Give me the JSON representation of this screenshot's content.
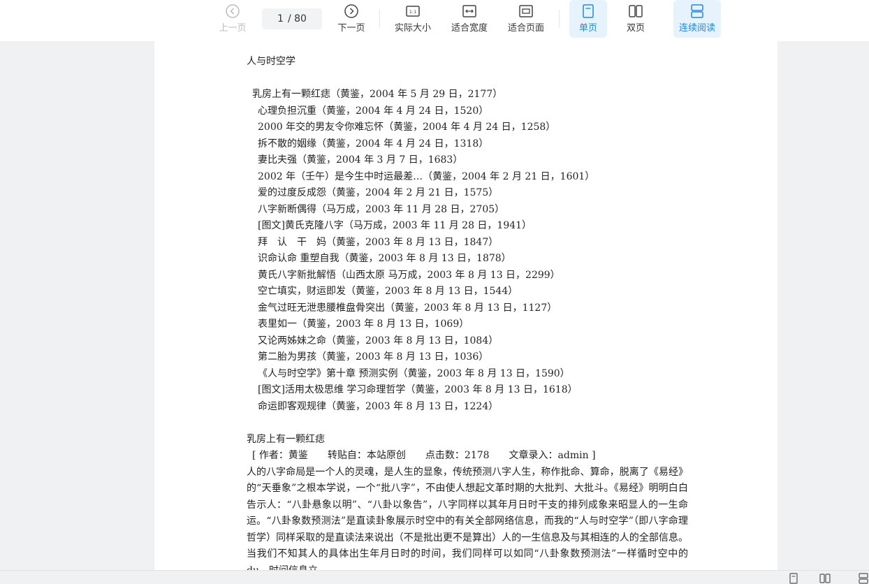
{
  "toolbar": {
    "prev_label": "上一页",
    "next_label": "下一页",
    "page_current": "1",
    "page_total": "/ 80",
    "actual_size_label": "实际大小",
    "fit_width_label": "适合宽度",
    "fit_page_label": "适合页面",
    "single_page_label": "单页",
    "double_page_label": "双页",
    "continuous_label": "连续阅读",
    "actual_size_icon_text": "1:1"
  },
  "document": {
    "title": "人与时空学",
    "toc": [
      "乳房上有一颗红痣（黄鉴，2004 年 5 月 29 日，2177）",
      "心理负担沉重（黄鉴，2004 年 4 月 24 日，1520）",
      "2000 年交的男友令你难忘怀（黄鉴，2004 年 4 月 24 日，1258）",
      "拆不散的姻缘（黄鉴，2004 年 4 月 24 日，1318）",
      "妻比夫强（黄鉴，2004 年 3 月 7 日，1683）",
      "2002 年（壬午）是今生中时运最差…（黄鉴，2004 年 2 月 21 日，1601）",
      "爱的过度反成怨（黄鉴，2004 年 2 月 21 日，1575）",
      "八字新断偶得（马万成，2003 年 11 月 28 日，2705）",
      "[图文]黄氏克隆八字（马万成，2003 年 11 月 28 日，1941）",
      "拜　认　干　妈（黄鉴，2003 年 8 月 13 日，1847）",
      "识命认命 重塑自我（黄鉴，2003 年 8 月 13 日，1878）",
      "黄氏八字新批解悟（山西太原 马万成，2003 年 8 月 13 日，2299）",
      "空亡填实，财运即发（黄鉴，2003 年 8 月 13 日，1544）",
      "金气过旺无泄患腰椎盘骨突出（黄鉴，2003 年 8 月 13 日，1127）",
      "表里如一（黄鉴，2003 年 8 月 13 日，1069）",
      "又论两姊妹之命（黄鉴，2003 年 8 月 13 日，1084）",
      "第二胎为男孩（黄鉴，2003 年 8 月 13 日，1036）",
      "《人与时空学》第十章 预测实例（黄鉴，2003 年 8 月 13 日，1590）",
      "[图文]活用太极思维 学习命理哲学（黄鉴，2003 年 8 月 13 日，1618）",
      "命运即客观规律（黄鉴，2003 年 8 月 13 日，1224）"
    ],
    "article_title": "乳房上有一颗红痣",
    "meta": "[ 作者：黄鉴　　转贴自：本站原创　　点击数：2178　　文章录入：admin ]",
    "body": "人的八字命局是一个人的灵魂，是人生的显象，传统预测八字人生，称作批命、算命，脱离了《易经》的“天垂象”之根本学说，一个“批八字”，不由使人想起文革时期的大批判、大批斗。《易经》明明白白告示人：“八卦悬象以明”、“八卦以象告”，八字同样以其年月日时干支的排列成象来昭显人的一生命运。“八卦象数预测法”是直读卦象展示时空中的有关全部网络信息，而我的“人与时空学”（即八字命理哲学）同样采取的是直读法来说出（不是批出更不是算出）人的一生信息及与其相连的人的全部信息。当我们不知其人的具体出生年月日时的时间，我们同样可以如同“八卦象数预测法”一样循时空中的du，时间信息立"
  },
  "colors": {
    "accent": "#1e88e5",
    "active_bg": "#e6f3fd",
    "disabled": "#bbbbbb"
  }
}
